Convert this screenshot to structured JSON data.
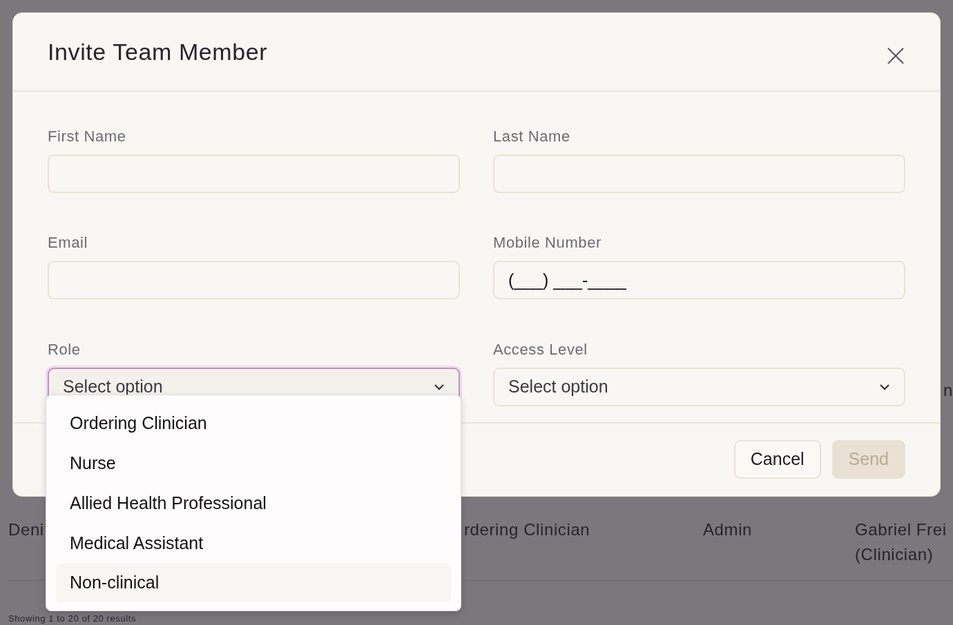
{
  "background_table": {
    "rows": [
      {
        "column_5": "n"
      },
      {
        "name": "Deni",
        "role": "rdering Clinician",
        "access": "Admin",
        "clinician": "Gabriel Frei",
        "clinician_note": "(Clinician)"
      }
    ],
    "footer": "Showing 1 to 20 of 20 results"
  },
  "modal": {
    "title": "Invite Team Member",
    "fields": [
      {
        "kind": "text",
        "label": "First Name"
      },
      {
        "kind": "text",
        "label": "Last Name"
      },
      {
        "kind": "text",
        "label": "Email"
      },
      {
        "kind": "text",
        "label": "Mobile Number",
        "value": "(___) ___-____"
      },
      {
        "kind": "select",
        "label": "Role",
        "placeholder": "Select option",
        "focused": true
      },
      {
        "kind": "select",
        "label": "Access Level",
        "placeholder": "Select option",
        "focused": false
      }
    ],
    "dropdown": {
      "options": [
        {
          "label": "Ordering Clinician",
          "highlighted": false
        },
        {
          "label": "Nurse",
          "highlighted": false
        },
        {
          "label": "Allied Health Professional",
          "highlighted": false
        },
        {
          "label": "Medical Assistant",
          "highlighted": false
        },
        {
          "label": "Non-clinical",
          "highlighted": true
        }
      ]
    },
    "buttons": [
      {
        "kind": "secondary",
        "label": "Cancel",
        "disabled": false
      },
      {
        "kind": "primary",
        "label": "Send",
        "disabled": true
      }
    ]
  }
}
